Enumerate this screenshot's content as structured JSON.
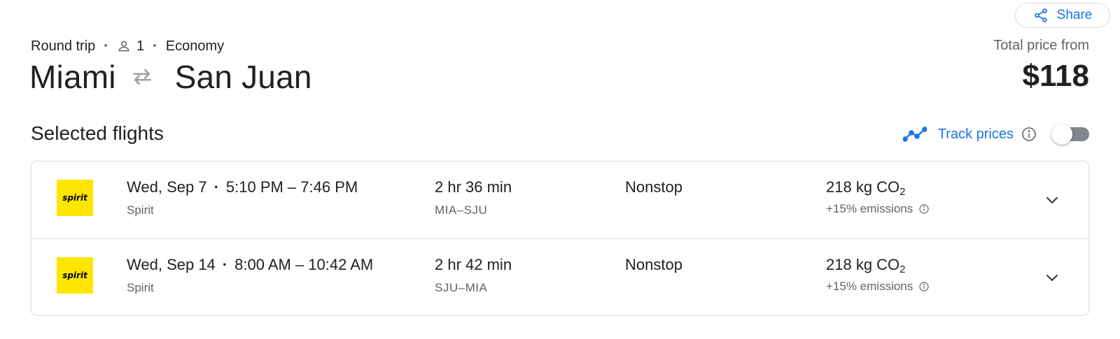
{
  "header": {
    "share_label": "Share",
    "trip_type": "Round trip",
    "passengers": "1",
    "cabin_class": "Economy",
    "origin": "Miami",
    "destination": "San Juan",
    "price_label": "Total price from",
    "price_value": "$118"
  },
  "section": {
    "title": "Selected flights",
    "track_label": "Track prices",
    "track_enabled": false
  },
  "flights": [
    {
      "date": "Wed, Sep 7",
      "time_range": "5:10 PM – 7:46 PM",
      "airline": "Spirit",
      "airline_logo_text": "spirit",
      "duration": "2 hr 36 min",
      "airports": "MIA–SJU",
      "stops": "Nonstop",
      "co2_value": "218 kg CO",
      "co2_subscript": "2",
      "emissions": "+15% emissions"
    },
    {
      "date": "Wed, Sep 14",
      "time_range": "8:00 AM – 10:42 AM",
      "airline": "Spirit",
      "airline_logo_text": "spirit",
      "duration": "2 hr 42 min",
      "airports": "SJU–MIA",
      "stops": "Nonstop",
      "co2_value": "218 kg CO",
      "co2_subscript": "2",
      "emissions": "+15% emissions"
    }
  ],
  "icons": {
    "share": "share-icon",
    "person": "person-icon",
    "swap": "swap-arrows-icon",
    "trend": "trend-line-icon",
    "info": "info-icon",
    "expand": "chevron-down-icon"
  },
  "colors": {
    "accent": "#1a73e8",
    "spirit_yellow": "#ffe600",
    "text_primary": "#202124",
    "text_secondary": "#5f6368",
    "border": "#dadce0"
  }
}
